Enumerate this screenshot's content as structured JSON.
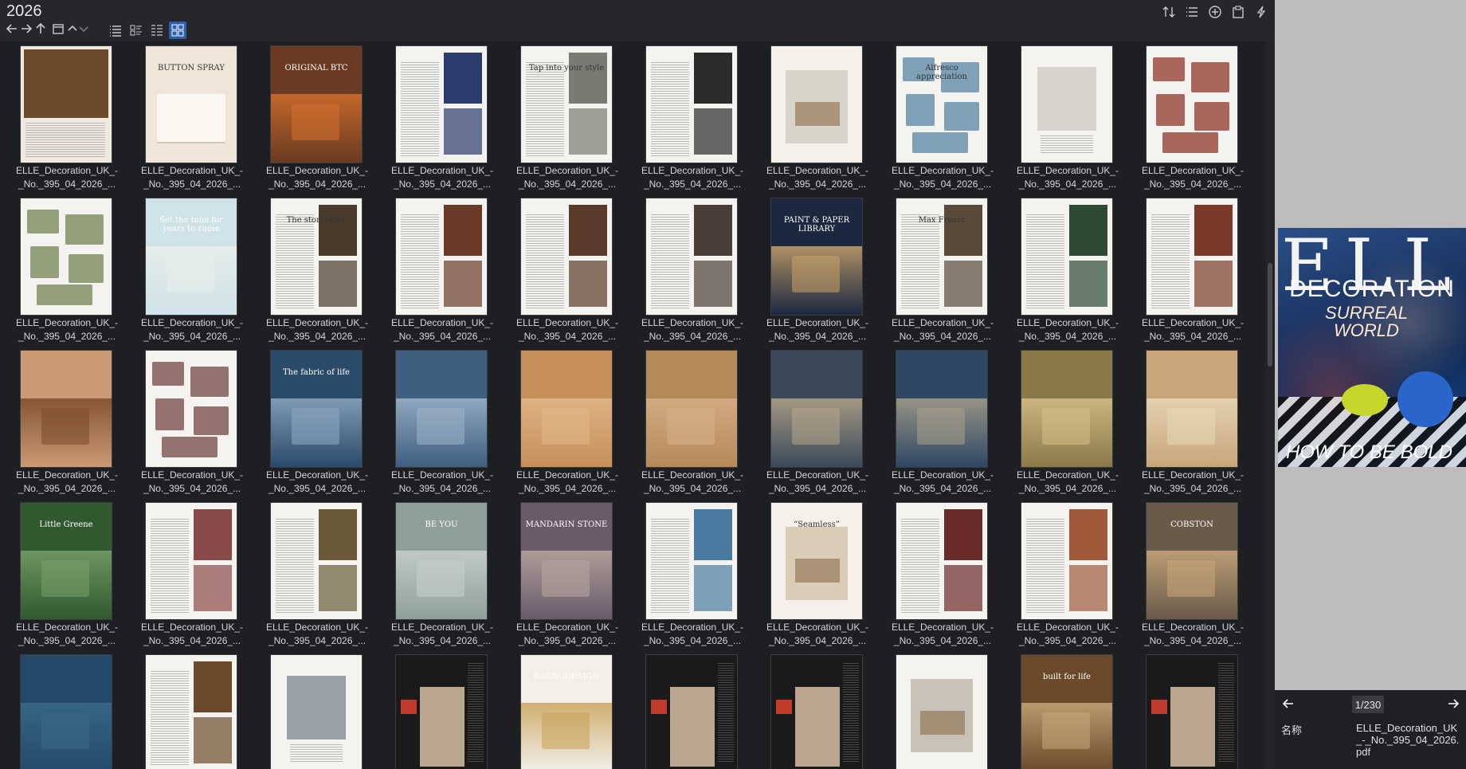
{
  "window": {
    "folder_title": "2026"
  },
  "toolbar_icons": [
    "arrow-left-icon",
    "arrow-right-icon",
    "arrow-up-icon",
    "folder-icon",
    "chevron-up-icon",
    "chevron-down-icon",
    "list-view-icon",
    "detail-view-icon",
    "compact-list-icon",
    "grid-view-icon"
  ],
  "right_tools": [
    "sort-icon",
    "menu-list-icon",
    "add-circle-icon",
    "clipboard-icon",
    "lightning-icon"
  ],
  "file_label_line1": "ELLE_Decoration_UK_-",
  "file_label_line2": "_No._395_04_2026_...",
  "thumbnails": [
    {
      "bg": "#efe9df",
      "accent": "#6b4a2c",
      "text": "",
      "style": "photo-top"
    },
    {
      "bg": "#efe6d9",
      "accent": "#d9cfc0",
      "text": "BUTTON SPRAY",
      "style": "bed"
    },
    {
      "bg": "#6a3a22",
      "accent": "#d36f2c",
      "text": "ORIGINAL BTC",
      "style": "full"
    },
    {
      "bg": "#f5f3ef",
      "accent": "#2b3b6b",
      "text": "",
      "style": "split"
    },
    {
      "bg": "#f5f3ef",
      "accent": "#7a7a73",
      "text": "Tap into your style",
      "style": "split"
    },
    {
      "bg": "#f5f3ef",
      "accent": "#2a2a2a",
      "text": "",
      "style": "split"
    },
    {
      "bg": "#f5f1ea",
      "accent": "#d9d4c9",
      "text": "",
      "style": "kitchen"
    },
    {
      "bg": "#f5f3ef",
      "accent": "#4c7ea1",
      "text": "Alfresco appreciation",
      "style": "products"
    },
    {
      "bg": "#f5f3ef",
      "accent": "#d7d3cc",
      "text": "",
      "style": "room"
    },
    {
      "bg": "#f5f3ef",
      "accent": "#8a2a1f",
      "text": "",
      "style": "products"
    },
    {
      "bg": "#f5f3ef",
      "accent": "#6b7a4a",
      "text": "",
      "style": "products"
    },
    {
      "bg": "#cfe2e8",
      "accent": "#e9efe9",
      "text": "Set the tone for years to come",
      "style": "full"
    },
    {
      "bg": "#f5f3ef",
      "accent": "#4a3a2c",
      "text": "The storyteller",
      "style": "split"
    },
    {
      "bg": "#f5f3ef",
      "accent": "#6a3a28",
      "text": "",
      "style": "split"
    },
    {
      "bg": "#f5f3ef",
      "accent": "#5a3a2a",
      "text": "",
      "style": "split"
    },
    {
      "bg": "#f5f3ef",
      "accent": "#4a3f38",
      "text": "",
      "style": "split"
    },
    {
      "bg": "#1c2740",
      "accent": "#c8a36b",
      "text": "PAINT & PAPER LIBRARY",
      "style": "full"
    },
    {
      "bg": "#f5f3ef",
      "accent": "#5a4a3a",
      "text": "Max Fraser",
      "style": "split"
    },
    {
      "bg": "#f5f3ef",
      "accent": "#2e4a35",
      "text": "",
      "style": "split"
    },
    {
      "bg": "#f5f3ef",
      "accent": "#7a3a2a",
      "text": "",
      "style": "split"
    },
    {
      "bg": "#c99a73",
      "accent": "#7a4a2a",
      "text": "",
      "style": "full"
    },
    {
      "bg": "#f5f3ef",
      "accent": "#6a3a3a",
      "text": "",
      "style": "products"
    },
    {
      "bg": "#2a4a6a",
      "accent": "#8fa9c2",
      "text": "The fabric of life",
      "style": "full"
    },
    {
      "bg": "#3e5f80",
      "accent": "#9fb4c9",
      "text": "",
      "style": "full"
    },
    {
      "bg": "#c58f5a",
      "accent": "#e2b88a",
      "text": "",
      "style": "full"
    },
    {
      "bg": "#b58a5a",
      "accent": "#d8b088",
      "text": "",
      "style": "full"
    },
    {
      "bg": "#3a4a5a",
      "accent": "#b7a58a",
      "text": "",
      "style": "full"
    },
    {
      "bg": "#2e4764",
      "accent": "#a9a18a",
      "text": "",
      "style": "full"
    },
    {
      "bg": "#8a7a4a",
      "accent": "#d7c08a",
      "text": "",
      "style": "full"
    },
    {
      "bg": "#c8a67a",
      "accent": "#e8d8b8",
      "text": "",
      "style": "full"
    },
    {
      "bg": "#2f5a2f",
      "accent": "#7aa06a",
      "text": "Little Greene",
      "style": "full"
    },
    {
      "bg": "#f5f3ef",
      "accent": "#8a4a4a",
      "text": "",
      "style": "split"
    },
    {
      "bg": "#f5f3ef",
      "accent": "#6a5a3a",
      "text": "",
      "style": "split"
    },
    {
      "bg": "#8fa09a",
      "accent": "#c8d1cc",
      "text": "BE YOU",
      "style": "full"
    },
    {
      "bg": "#6a5a6a",
      "accent": "#b8a8a0",
      "text": "MANDARIN STONE",
      "style": "full"
    },
    {
      "bg": "#f5f3ef",
      "accent": "#4a7aa0",
      "text": "",
      "style": "split"
    },
    {
      "bg": "#f5f1ea",
      "accent": "#d9cdb8",
      "text": "“Seamless”",
      "style": "kitchen"
    },
    {
      "bg": "#f5f3ef",
      "accent": "#6a2a2a",
      "text": "",
      "style": "split"
    },
    {
      "bg": "#f5f3ef",
      "accent": "#a05a3a",
      "text": "",
      "style": "split"
    },
    {
      "bg": "#6a5a4a",
      "accent": "#c8a87a",
      "text": "COBSTON",
      "style": "full"
    },
    {
      "bg": "#234a6a",
      "accent": "#3a6a8a",
      "text": "",
      "style": "full"
    },
    {
      "bg": "#f5f3ef",
      "accent": "#6a4a2a",
      "text": "",
      "style": "split"
    },
    {
      "bg": "#f5f3ef",
      "accent": "#9aa0a8",
      "text": "",
      "style": "room"
    },
    {
      "bg": "#1a1a1a",
      "accent": "#c23a2a",
      "text": "",
      "style": "dark"
    },
    {
      "bg": "#f2efe8",
      "accent": "#c9a35a",
      "text": "BAGNODESIGN",
      "style": "full"
    },
    {
      "bg": "#1a1a1a",
      "accent": "#c23a2a",
      "text": "",
      "style": "dark"
    },
    {
      "bg": "#1a1a1a",
      "accent": "#c23a2a",
      "text": "",
      "style": "dark"
    },
    {
      "bg": "#f5f3ef",
      "accent": "#c9c2b8",
      "text": "",
      "style": "kitchen"
    },
    {
      "bg": "#6a4a2a",
      "accent": "#c8a87a",
      "text": "built for life",
      "style": "full"
    },
    {
      "bg": "#1a1a1a",
      "accent": "#c23a2a",
      "text": "",
      "style": "dark"
    }
  ],
  "preview": {
    "brand": "ELLE",
    "sub": "DECORATION",
    "headline": "SURREAL WORLD",
    "bottom_line": "HOW TO BE BOLD",
    "page_counter": "1/230",
    "info_label": "名称",
    "info_value": "ELLE_Decoration_UK_-_No._395_04_2026.pdf"
  }
}
